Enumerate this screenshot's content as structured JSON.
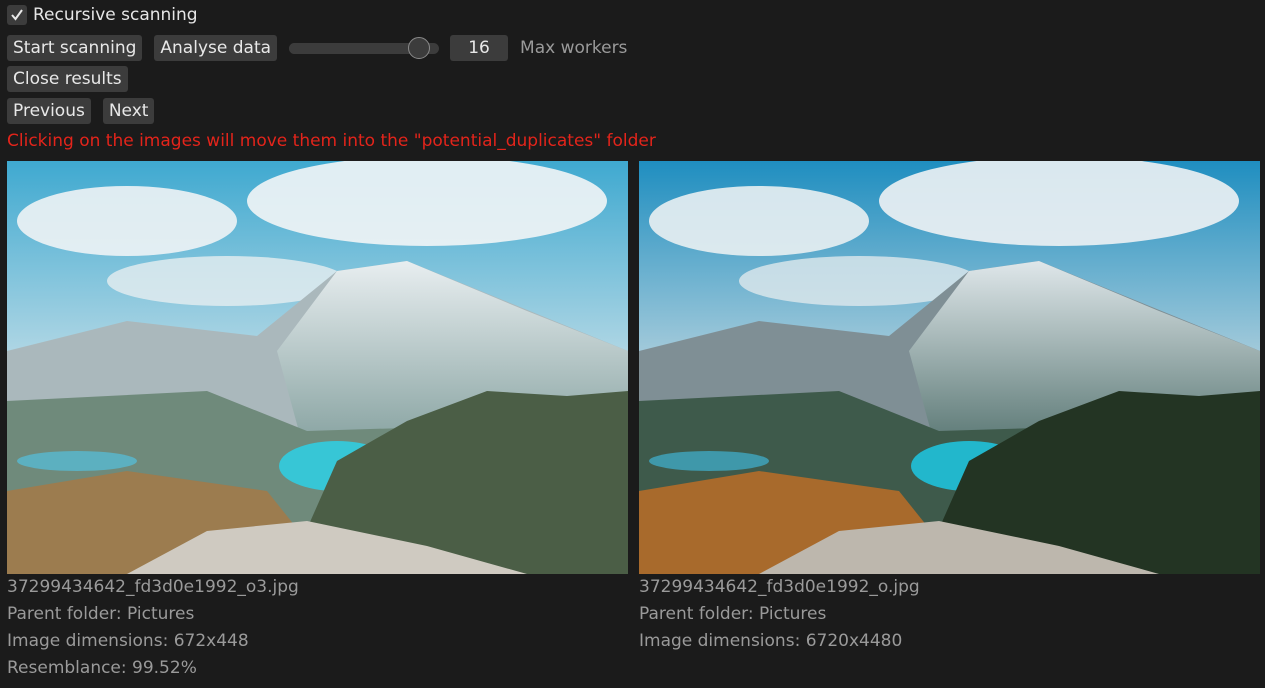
{
  "recursive": {
    "label": "Recursive scanning",
    "checked": true
  },
  "toolbar": {
    "start_label": "Start scanning",
    "analyse_label": "Analyse data",
    "slider_fraction": 0.93,
    "workers_value": "16",
    "workers_label": "Max workers"
  },
  "close_label": "Close results",
  "nav": {
    "previous_label": "Previous",
    "next_label": "Next"
  },
  "warning": "Clicking on the images will move them into the \"potential_duplicates\" folder",
  "images": [
    {
      "filename": "37299434642_fd3d0e1992_o3.jpg",
      "parent": "Parent folder: Pictures",
      "dimensions": "Image dimensions: 672x448",
      "resemblance": "Resemblance: 99.52%"
    },
    {
      "filename": "37299434642_fd3d0e1992_o.jpg",
      "parent": "Parent folder: Pictures",
      "dimensions": "Image dimensions: 6720x4480"
    }
  ],
  "colors": {
    "warning": "#e3241b",
    "button": "#3c3c3c",
    "background": "#1b1b1b"
  }
}
